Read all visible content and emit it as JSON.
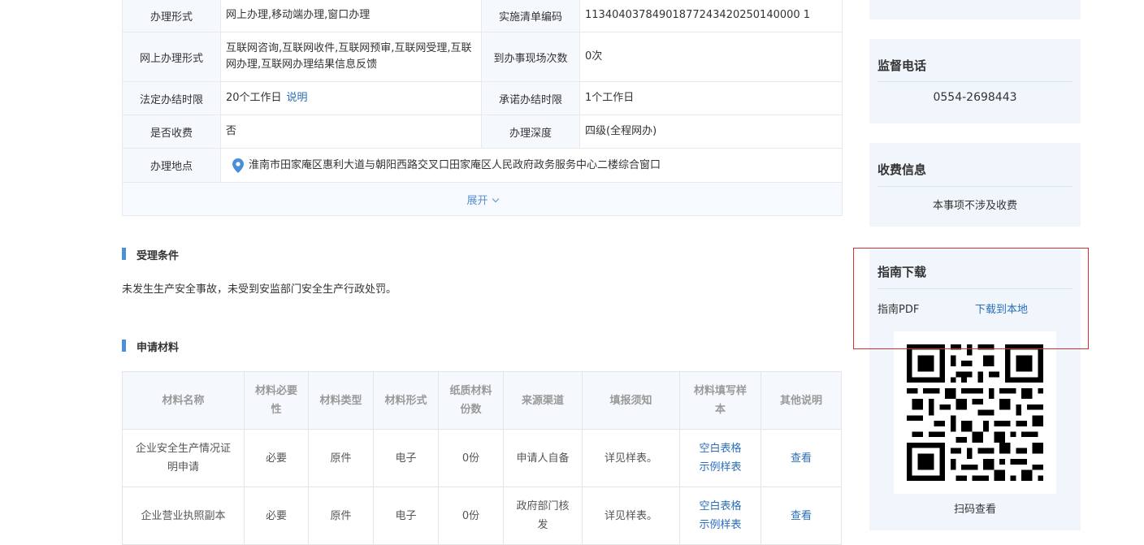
{
  "info": {
    "r1": {
      "l1": "办理形式",
      "v1": "网上办理,移动端办理,窗口办理",
      "l2": "实施清单编码",
      "v2": "11340403784901877243420250140000 1"
    },
    "r2": {
      "l1": "网上办理形式",
      "v1": "互联网咨询,互联网收件,互联网预审,互联网受理,互联网办理,互联网办理结果信息反馈",
      "l2": "到办事现场次数",
      "v2": "0次"
    },
    "r3": {
      "l1": "法定办结时限",
      "v1": "20个工作日",
      "link": "说明",
      "l2": "承诺办结时限",
      "v2": "1个工作日"
    },
    "r4": {
      "l1": "是否收费",
      "v1": "否",
      "l2": "办理深度",
      "v2": "四级(全程网办)"
    },
    "r5": {
      "l1": "办理地点",
      "v1": "淮南市田家庵区惠利大道与朝阳西路交叉口田家庵区人民政府政务服务中心二楼综合窗口"
    },
    "expand": "展开"
  },
  "conditions": {
    "title": "受理条件",
    "text": "未发生生产安全事故，未受到安监部门安全生产行政处罚。"
  },
  "materials": {
    "title": "申请材料",
    "headers": [
      "材料名称",
      "材料必要性",
      "材料类型",
      "材料形式",
      "纸质材料份数",
      "来源渠道",
      "填报须知",
      "材料填写样本",
      "其他说明"
    ],
    "rows": [
      {
        "name": "企业安全生产情况证明申请",
        "need": "必要",
        "type": "原件",
        "form": "电子",
        "copies": "0份",
        "source": "申请人自备",
        "notice": "详见样表。",
        "blank": "空白表格",
        "sample": "示例样表",
        "other": "查看"
      },
      {
        "name": "企业营业执照副本",
        "need": "必要",
        "type": "原件",
        "form": "电子",
        "copies": "0份",
        "source": "政府部门核发",
        "notice": "详见样表。",
        "blank": "空白表格",
        "sample": "示例样表",
        "other": "查看"
      }
    ]
  },
  "sidebar": {
    "phone": {
      "title": "监督电话",
      "value": "0554-2698443"
    },
    "fee": {
      "title": "收费信息",
      "value": "本事项不涉及收费"
    },
    "guide": {
      "title": "指南下载",
      "label": "指南PDF",
      "link": "下载到本地",
      "qr_label": "扫码查看"
    }
  },
  "colors": {
    "accent": "#4a90d9",
    "link": "#2a6ebb",
    "highlight_border": "#cc3333"
  }
}
